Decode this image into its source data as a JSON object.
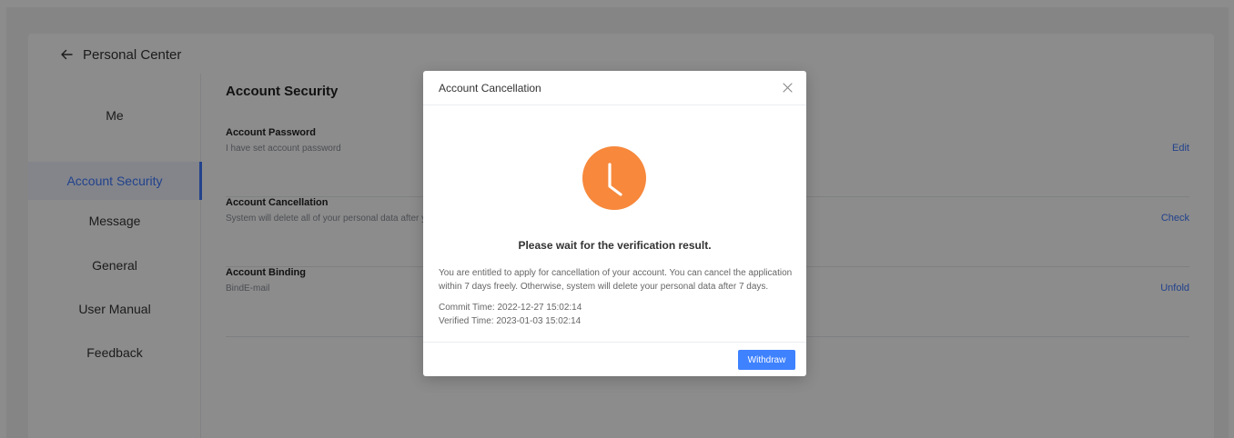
{
  "header": {
    "back_icon": "arrow-left-icon",
    "title": "Personal Center"
  },
  "sidebar": {
    "items": [
      {
        "label": "Me",
        "active": false
      },
      {
        "label": "Account Security",
        "active": true
      },
      {
        "label": "Message",
        "active": false
      },
      {
        "label": "General",
        "active": false
      },
      {
        "label": "User Manual",
        "active": false
      },
      {
        "label": "Feedback",
        "active": false
      }
    ]
  },
  "main": {
    "section_title": "Account Security",
    "rows": [
      {
        "title": "Account Password",
        "desc": "I have set account password",
        "action": "Edit"
      },
      {
        "title": "Account Cancellation",
        "desc": "System will delete all of your personal data after you",
        "action": "Check"
      },
      {
        "title": "Account Binding",
        "desc": "BindE-mail",
        "action": "Unfold"
      }
    ]
  },
  "modal": {
    "title": "Account Cancellation",
    "close_icon": "close-icon",
    "status_icon": "clock-icon",
    "status_text": "Please wait for the verification result.",
    "description": "You are entitled to apply for cancellation of your account. You can cancel the application within 7 days freely. Otherwise, system will delete your personal data after 7 days.",
    "commit_time": "Commit Time: 2022-12-27 15:02:14",
    "verified_time": "Verified Time: 2023-01-03 15:02:14",
    "withdraw_label": "Withdraw"
  },
  "colors": {
    "accent": "#3f78ff",
    "status_orange": "#f7883c",
    "overlay": "rgba(0,0,0,0.45)"
  }
}
